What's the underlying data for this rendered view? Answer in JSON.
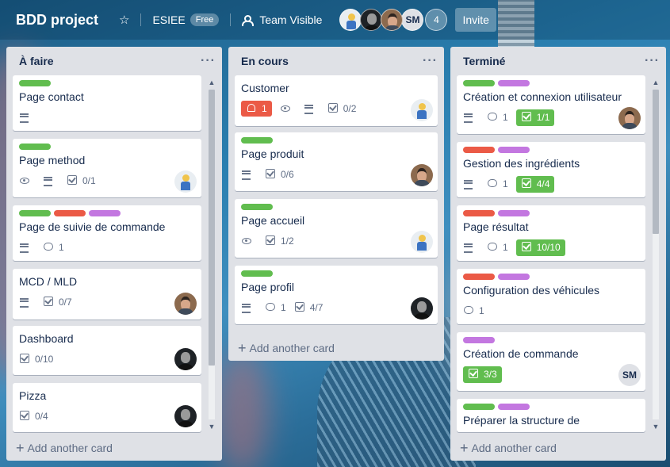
{
  "header": {
    "board_title": "BDD project",
    "workspace": "ESIEE",
    "plan_badge": "Free",
    "visibility": "Team Visible",
    "member_initials": "SM",
    "member_count": "4",
    "invite_label": "Invite"
  },
  "lists": [
    {
      "title": "À faire",
      "add_card": "Add another card",
      "cards": [
        {
          "title": "Page contact"
        },
        {
          "title": "Page method",
          "checklist": "0/1"
        },
        {
          "title": "Page de suivie de commande",
          "comments": "1"
        },
        {
          "title": "MCD / MLD",
          "checklist": "0/7"
        },
        {
          "title": "Dashboard",
          "checklist": "0/10"
        },
        {
          "title": "Pizza",
          "checklist": "0/4"
        }
      ]
    },
    {
      "title": "En cours",
      "add_card": "Add another card",
      "cards": [
        {
          "title": "Customer",
          "due": "1",
          "checklist": "0/2"
        },
        {
          "title": "Page produit",
          "checklist": "0/6"
        },
        {
          "title": "Page accueil",
          "checklist": "1/2"
        },
        {
          "title": "Page profil",
          "comments": "1",
          "checklist": "4/7"
        }
      ]
    },
    {
      "title": "Terminé",
      "add_card": "Add another card",
      "cards": [
        {
          "title": "Création et connexion utilisateur",
          "comments": "1",
          "checklist": "1/1"
        },
        {
          "title": "Gestion des ingrédients",
          "comments": "1",
          "checklist": "4/4"
        },
        {
          "title": "Page résultat",
          "comments": "1",
          "checklist": "10/10"
        },
        {
          "title": "Configuration des véhicules",
          "comments": "1"
        },
        {
          "title": "Création de commande",
          "checklist": "3/3",
          "avatar_initials": "SM"
        },
        {
          "title": "Préparer la structure de"
        }
      ]
    }
  ],
  "colors": {
    "green": "#61bd4f",
    "red": "#eb5a46",
    "purple": "#c377e0"
  }
}
